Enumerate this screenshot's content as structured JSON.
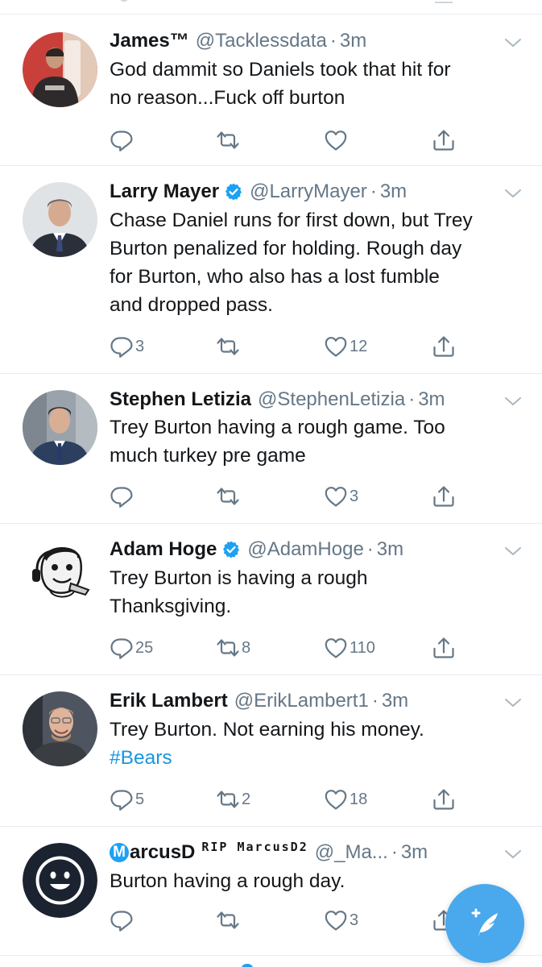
{
  "tweets": [
    {
      "name": "James™",
      "handle": "@Tacklessdata",
      "separator": "·",
      "time": "3m",
      "text": [
        "God dammit so Daniels took that hit for",
        "no reason...Fuck off burton"
      ],
      "replies": "",
      "retweets": "",
      "likes": ""
    },
    {
      "name": "Larry Mayer",
      "verified": true,
      "handle": "@LarryMayer",
      "separator": "·",
      "time": "3m",
      "text": [
        "Chase Daniel runs for first down, but Trey",
        "Burton penalized for holding. Rough day",
        "for Burton, who also has a lost fumble",
        "and dropped pass."
      ],
      "replies": "3",
      "retweets": "",
      "likes": "12"
    },
    {
      "name": "Stephen Letizia",
      "handle": "@StephenLetizia",
      "separator": "·",
      "time": "3m",
      "text": [
        "Trey Burton having a rough game. Too",
        "much turkey pre game"
      ],
      "replies": "",
      "retweets": "",
      "likes": "3"
    },
    {
      "name": "Adam Hoge",
      "verified": true,
      "handle": "@AdamHoge",
      "separator": "·",
      "time": "3m",
      "text": [
        "Trey Burton is having a rough",
        "Thanksgiving."
      ],
      "replies": "25",
      "retweets": "8",
      "likes": "110"
    },
    {
      "name": "Erik Lambert",
      "handle": "@ErikLambert1",
      "separator": "·",
      "time": "3m",
      "text": [
        "Trey Burton. Not earning his money."
      ],
      "hashtag": "#Bears",
      "replies": "5",
      "retweets": "2",
      "likes": "18"
    },
    {
      "name_badge": "M",
      "name": "arcusD",
      "name_suffix": "ᴿᴵᴾ ᴹᵃʳᶜᵘˢᴰ²",
      "name_suffix_plain": "RIP MarcusD2",
      "handle": "@_Ma...",
      "separator": "·",
      "time": "3m",
      "text": [
        "Burton having a rough day."
      ],
      "replies": "",
      "retweets": "",
      "likes": "3"
    }
  ],
  "icons": {
    "reply": "reply-icon",
    "retweet": "retweet-icon",
    "like": "like-icon",
    "share": "share-icon",
    "caret": "chevron-down-icon",
    "verified": "verified-badge-icon",
    "compose": "compose-tweet-icon"
  },
  "colors": {
    "accent": "#1da1f2",
    "hashtag": "#1b95e0",
    "secondary_text": "#657786",
    "divider": "#e6ecf0",
    "fab": "#4aa8ec"
  }
}
